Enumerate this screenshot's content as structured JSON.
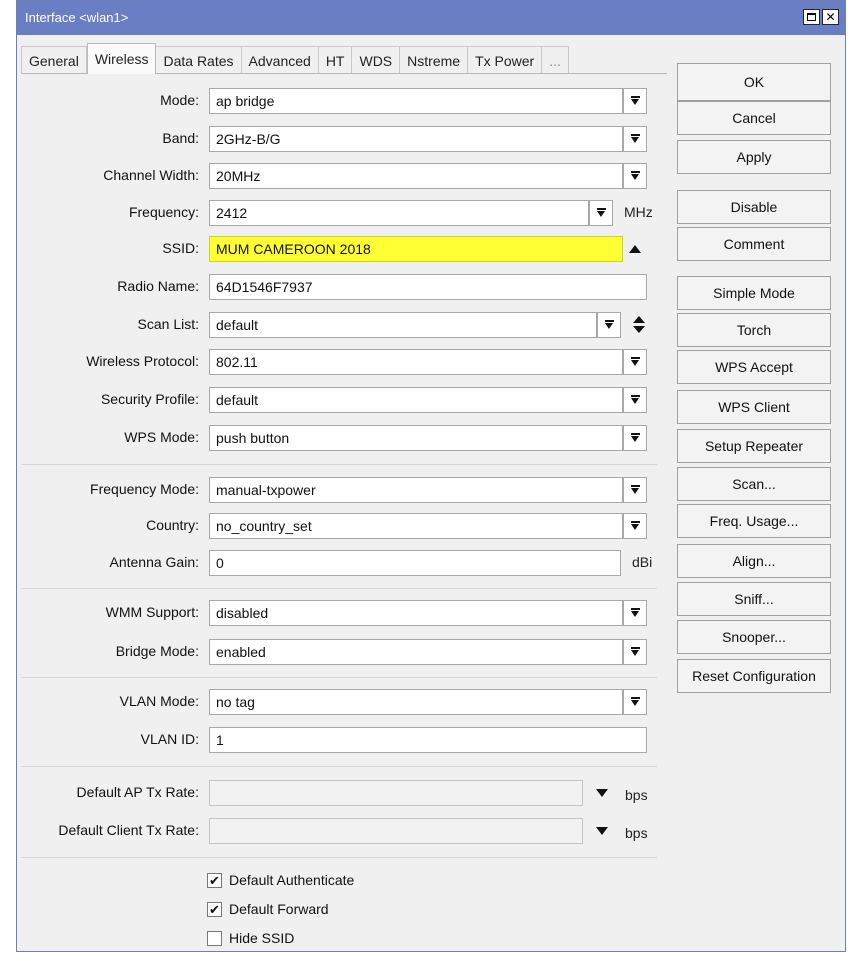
{
  "window": {
    "title": "Interface <wlan1>",
    "minimize_glyph": "□",
    "close_glyph": "✕"
  },
  "tabs": [
    "General",
    "Wireless",
    "Data Rates",
    "Advanced",
    "HT",
    "WDS",
    "Nstreme",
    "Tx Power",
    "..."
  ],
  "active_tab": "Wireless",
  "form": {
    "mode": {
      "label": "Mode:",
      "value": "ap bridge"
    },
    "band": {
      "label": "Band:",
      "value": "2GHz-B/G"
    },
    "channel_width": {
      "label": "Channel Width:",
      "value": "20MHz"
    },
    "frequency": {
      "label": "Frequency:",
      "value": "2412",
      "unit": "MHz"
    },
    "ssid": {
      "label": "SSID:",
      "value": "MUM CAMEROON 2018",
      "highlight": "#ffff33"
    },
    "radio_name": {
      "label": "Radio Name:",
      "value": "64D1546F7937"
    },
    "scan_list": {
      "label": "Scan List:",
      "value": "default"
    },
    "wireless_protocol": {
      "label": "Wireless Protocol:",
      "value": "802.11"
    },
    "security_profile": {
      "label": "Security Profile:",
      "value": "default"
    },
    "wps_mode": {
      "label": "WPS Mode:",
      "value": "push button"
    },
    "frequency_mode": {
      "label": "Frequency Mode:",
      "value": "manual-txpower"
    },
    "country": {
      "label": "Country:",
      "value": "no_country_set"
    },
    "antenna_gain": {
      "label": "Antenna Gain:",
      "value": "0",
      "unit": "dBi"
    },
    "wmm_support": {
      "label": "WMM Support:",
      "value": "disabled"
    },
    "bridge_mode": {
      "label": "Bridge Mode:",
      "value": "enabled"
    },
    "vlan_mode": {
      "label": "VLAN Mode:",
      "value": "no tag"
    },
    "vlan_id": {
      "label": "VLAN ID:",
      "value": "1"
    },
    "default_ap_tx_rate": {
      "label": "Default AP Tx Rate:",
      "value": "",
      "unit": "bps"
    },
    "default_client_tx_rate": {
      "label": "Default Client Tx Rate:",
      "value": "",
      "unit": "bps"
    },
    "checkboxes": [
      {
        "label": "Default Authenticate",
        "checked": true,
        "mark": "✔"
      },
      {
        "label": "Default Forward",
        "checked": true,
        "mark": "✔"
      },
      {
        "label": "Hide SSID",
        "checked": false,
        "mark": ""
      }
    ]
  },
  "buttons": {
    "ok": "OK",
    "cancel": "Cancel",
    "apply": "Apply",
    "disable": "Disable",
    "comment": "Comment",
    "simple_mode": "Simple Mode",
    "torch": "Torch",
    "wps_accept": "WPS Accept",
    "wps_client": "WPS Client",
    "setup_repeater": "Setup Repeater",
    "scan": "Scan...",
    "freq_usage": "Freq. Usage...",
    "align": "Align...",
    "sniff": "Sniff...",
    "snooper": "Snooper...",
    "reset_configuration": "Reset Configuration"
  },
  "colors": {
    "titlebar": "#6a7ec4",
    "ssid_highlight": "#ffff33"
  }
}
